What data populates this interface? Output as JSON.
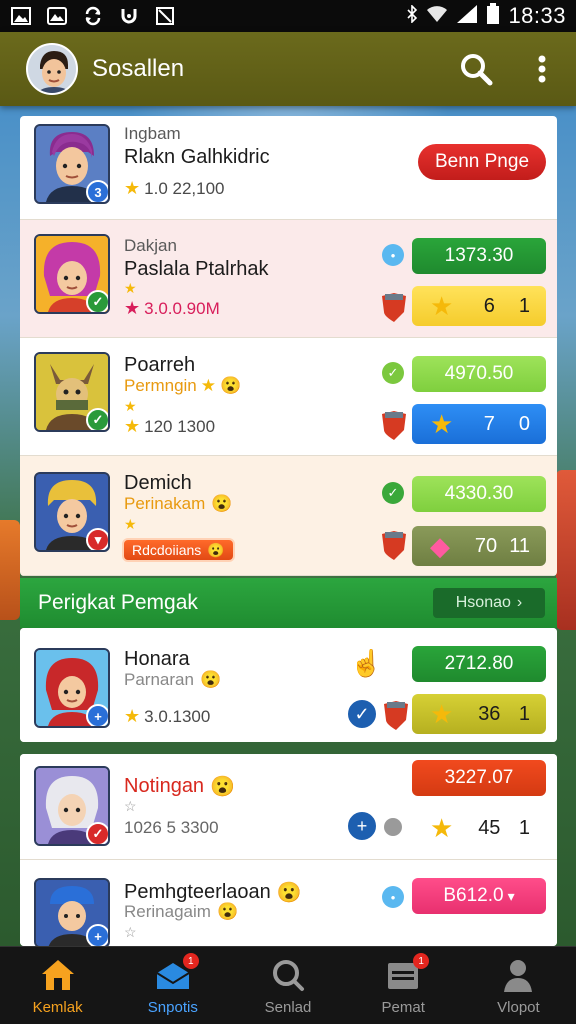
{
  "status_bar": {
    "time": "18:33",
    "left_icons": [
      "picture-icon",
      "mountain-icon",
      "sync-icon",
      "horseshoe-icon",
      "no-sim-icon"
    ],
    "right_icons": [
      "bluetooth-icon",
      "wifi-icon",
      "signal-icon",
      "battery-icon"
    ]
  },
  "app_bar": {
    "title": "Sosallen",
    "actions": [
      "search-icon",
      "more-icon"
    ]
  },
  "leaderboard": {
    "rows": [
      {
        "sub": "Ingbam",
        "name": "Rlakn Galhkidric",
        "meta": "1.0 22,100",
        "badge": "3",
        "button": "Benn Pnge"
      },
      {
        "sub": "Dakjan",
        "name": "Paslala Ptalrhak",
        "meta": "3.0.0.90M",
        "pill": "1373.30",
        "score_a": "6",
        "score_b": "1"
      },
      {
        "name": "Poarreh",
        "sub": "Permngin",
        "meta": "120 1300",
        "pill": "4970.50",
        "score_a": "7",
        "score_b": "0"
      },
      {
        "name": "Demich",
        "sub": "Perinakam",
        "chip": "Rdcdoiians",
        "pill": "4330.30",
        "score_a": "70",
        "score_b": "11"
      }
    ]
  },
  "section": {
    "title": "Perigkat Pemgak",
    "button": "Hsonao"
  },
  "ranking": {
    "rows": [
      {
        "name": "Honara",
        "sub": "Parnaran",
        "meta": "3.0.1300",
        "pill": "2712.80",
        "score_a": "36",
        "score_b": "1"
      },
      {
        "name": "Notingan",
        "meta": "1026 5 3300",
        "pill": "3227.07",
        "score_a": "45",
        "score_b": "1"
      },
      {
        "name": "Pemhgteerlaoan",
        "sub": "Rerinagaim",
        "pill": "B612.0"
      }
    ]
  },
  "bottom_nav": [
    {
      "label": "Kemlak",
      "icon": "home-icon",
      "active": true
    },
    {
      "label": "Snpotis",
      "icon": "inbox-icon",
      "badge": "1"
    },
    {
      "label": "Senlad",
      "icon": "search-icon"
    },
    {
      "label": "Pemat",
      "icon": "calendar-icon",
      "badge": "1"
    },
    {
      "label": "Vlopot",
      "icon": "profile-icon"
    }
  ],
  "colors": {
    "app_bar": "#5f5e18",
    "green": "#2aa53a",
    "red": "#e8312e",
    "yellow": "#f5cc2c",
    "blue": "#1a6fd8",
    "nav_active": "#f6a21f"
  }
}
